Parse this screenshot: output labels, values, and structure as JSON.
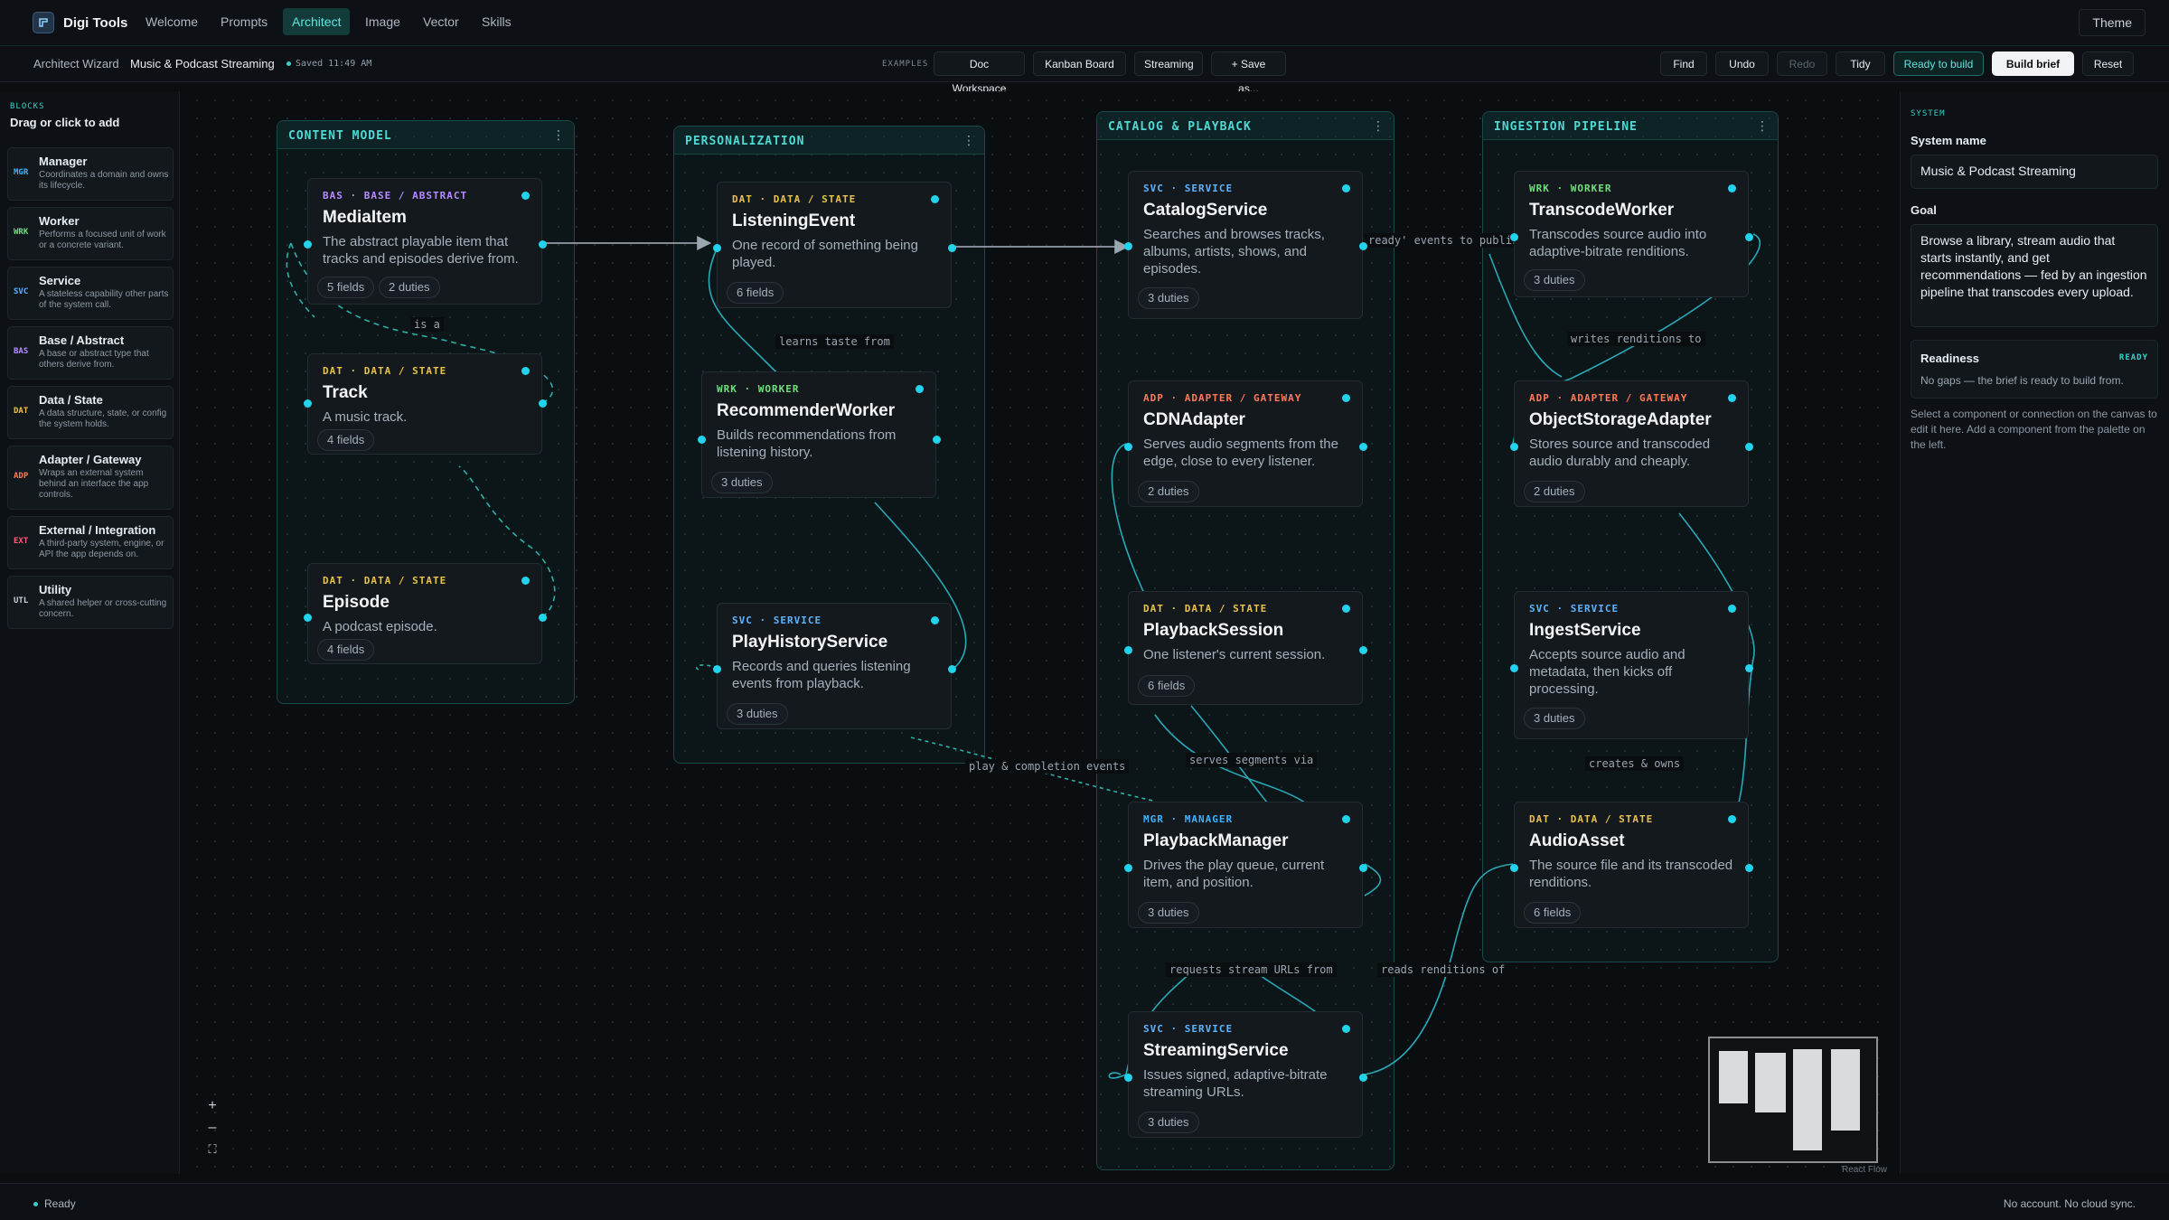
{
  "app": {
    "name": "Digi Tools",
    "logo_icon": "logo-icon"
  },
  "nav": {
    "tabs": [
      "Welcome",
      "Prompts",
      "Architect",
      "Image",
      "Vector",
      "Skills"
    ],
    "active": "Architect",
    "theme_label": "Theme"
  },
  "subbar": {
    "wizard_label": "Architect Wizard",
    "project_name": "Music & Podcast Streaming",
    "saved": "Saved 11:49 AM",
    "examples_label": "EXAMPLES",
    "examples": [
      "Doc Workspace",
      "Kanban Board",
      "Streaming",
      "+ Save as..."
    ],
    "actions": {
      "find": "Find",
      "undo": "Undo",
      "redo": "Redo",
      "tidy": "Tidy",
      "ready": "Ready to build",
      "build": "Build brief",
      "reset": "Reset"
    }
  },
  "palette": {
    "heading": "BLOCKS",
    "title": "Drag or click to add",
    "blocks": [
      {
        "tag": "MGR",
        "name": "Manager",
        "desc": "Coordinates a domain and owns its lifecycle."
      },
      {
        "tag": "WRK",
        "name": "Worker",
        "desc": "Performs a focused unit of work or a concrete variant."
      },
      {
        "tag": "SVC",
        "name": "Service",
        "desc": "A stateless capability other parts of the system call."
      },
      {
        "tag": "BAS",
        "name": "Base / Abstract",
        "desc": "A base or abstract type that others derive from."
      },
      {
        "tag": "DAT",
        "name": "Data / State",
        "desc": "A data structure, state, or config the system holds."
      },
      {
        "tag": "ADP",
        "name": "Adapter / Gateway",
        "desc": "Wraps an external system behind an interface the app controls."
      },
      {
        "tag": "EXT",
        "name": "External / Integration",
        "desc": "A third-party system, engine, or API the app depends on."
      },
      {
        "tag": "UTL",
        "name": "Utility",
        "desc": "A shared helper or cross-cutting concern."
      }
    ]
  },
  "groups": [
    "CONTENT MODEL",
    "PERSONALIZATION",
    "CATALOG & PLAYBACK",
    "INGESTION PIPELINE"
  ],
  "nodes": {
    "mediaitem": {
      "tag": "BAS · BASE / ABSTRACT",
      "title": "MediaItem",
      "desc": "The abstract playable item that tracks and episodes derive from.",
      "chips": [
        "5 fields",
        "2 duties"
      ]
    },
    "track": {
      "tag": "DAT · DATA / STATE",
      "title": "Track",
      "desc": "A music track.",
      "chips": [
        "4 fields"
      ]
    },
    "episode": {
      "tag": "DAT · DATA / STATE",
      "title": "Episode",
      "desc": "A podcast episode.",
      "chips": [
        "4 fields"
      ]
    },
    "listeningevent": {
      "tag": "DAT · DATA / STATE",
      "title": "ListeningEvent",
      "desc": "One record of something being played.",
      "chips": [
        "6 fields"
      ]
    },
    "recommender": {
      "tag": "WRK · WORKER",
      "title": "RecommenderWorker",
      "desc": "Builds recommendations from listening history.",
      "chips": [
        "3 duties"
      ]
    },
    "playhistory": {
      "tag": "SVC · SERVICE",
      "title": "PlayHistoryService",
      "desc": "Records and queries listening events from playback.",
      "chips": [
        "3 duties"
      ]
    },
    "catalog": {
      "tag": "SVC · SERVICE",
      "title": "CatalogService",
      "desc": "Searches and browses tracks, albums, artists, shows, and episodes.",
      "chips": [
        "3 duties"
      ]
    },
    "cdn": {
      "tag": "ADP · ADAPTER / GATEWAY",
      "title": "CDNAdapter",
      "desc": "Serves audio segments from the edge, close to every listener.",
      "chips": [
        "2 duties"
      ]
    },
    "session": {
      "tag": "DAT · DATA / STATE",
      "title": "PlaybackSession",
      "desc": "One listener's current session.",
      "chips": [
        "6 fields"
      ]
    },
    "manager": {
      "tag": "MGR · MANAGER",
      "title": "PlaybackManager",
      "desc": "Drives the play queue, current item, and position.",
      "chips": [
        "3 duties"
      ]
    },
    "streaming": {
      "tag": "SVC · SERVICE",
      "title": "StreamingService",
      "desc": "Issues signed, adaptive-bitrate streaming URLs.",
      "chips": [
        "3 duties"
      ]
    },
    "transcode": {
      "tag": "WRK · WORKER",
      "title": "TranscodeWorker",
      "desc": "Transcodes source audio into adaptive-bitrate renditions.",
      "chips": [
        "3 duties"
      ]
    },
    "objectstorage": {
      "tag": "ADP · ADAPTER / GATEWAY",
      "title": "ObjectStorageAdapter",
      "desc": "Stores source and transcoded audio durably and cheaply.",
      "chips": [
        "2 duties"
      ]
    },
    "ingest": {
      "tag": "SVC · SERVICE",
      "title": "IngestService",
      "desc": "Accepts source audio and metadata, then kicks off processing.",
      "chips": [
        "3 duties"
      ]
    },
    "audioasset": {
      "tag": "DAT · DATA / STATE",
      "title": "AudioAsset",
      "desc": "The source file and its transcoded renditions.",
      "chips": [
        "6 fields"
      ]
    }
  },
  "edge_labels": {
    "is_a": "is a",
    "learns": "learns taste from",
    "ready_events": "ready' events to publis",
    "writes": "writes renditions to",
    "play_events": "play & completion events",
    "serves": "serves segments via",
    "creates": "creates & owns",
    "requests": "requests stream URLs from",
    "reads": "reads renditions of"
  },
  "controls": {
    "zoom_in": "+",
    "zoom_out": "–",
    "fit": "⛶"
  },
  "minimap_attribution": "React Flow",
  "rpanel": {
    "heading": "SYSTEM",
    "name_label": "System name",
    "name_value": "Music & Podcast Streaming",
    "goal_label": "Goal",
    "goal_value": "Browse a library, stream audio that starts instantly, and get recommendations — fed by an ingestion pipeline that transcodes every upload.",
    "readiness_label": "Readiness",
    "readiness_badge": "READY",
    "readiness_text": "No gaps — the brief is ready to build from.",
    "help": "Select a component or connection on the canvas to edit it here. Add a component from the palette on the left."
  },
  "status": {
    "left": "Ready",
    "right": "No account. No cloud sync."
  },
  "colors": {
    "accent": "#22d3ee",
    "group_title": "#4fd9d3",
    "svc": "#5eb3ff",
    "dat": "#e8c24a",
    "wrk": "#6ee07a",
    "adp": "#ff7a59",
    "mgr": "#3fb2ff",
    "bas": "#b48cff"
  }
}
